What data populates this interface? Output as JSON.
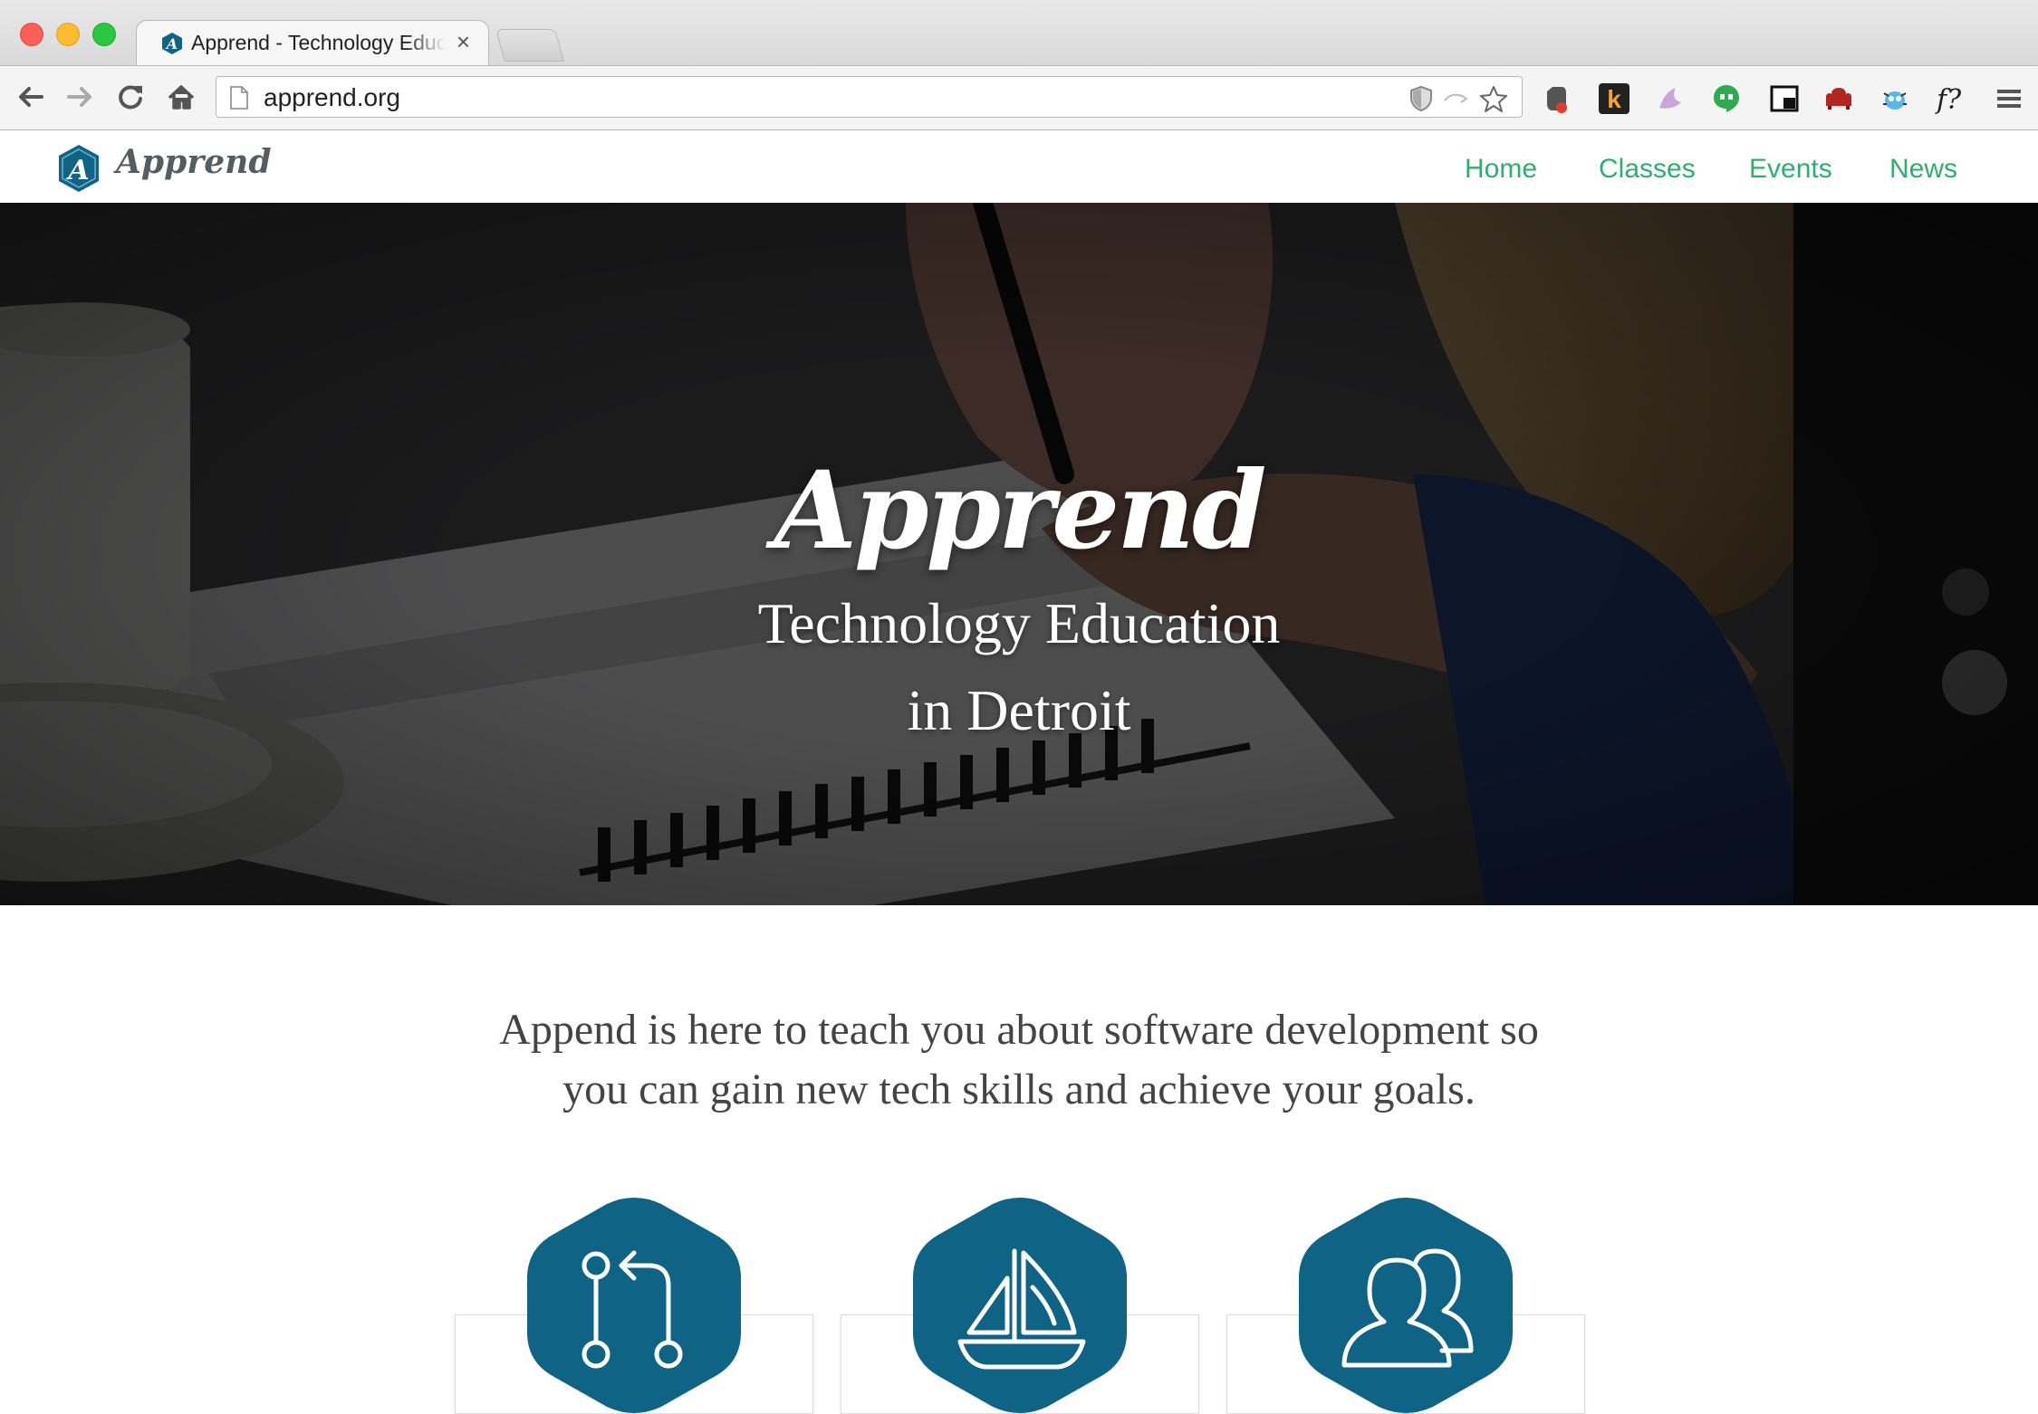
{
  "browser": {
    "tab_title": "Apprend - Technology Education in Detroit",
    "tab_close": "×",
    "address": "apprend.org"
  },
  "site": {
    "logo_text": "Apprend",
    "nav": [
      "Home",
      "Classes",
      "Events",
      "News"
    ],
    "accent_color": "#2bb070",
    "brand_color": "#0f6384"
  },
  "hero": {
    "title": "Apprend",
    "subtitle_line1": "Technology Education",
    "subtitle_line2": "in Detroit"
  },
  "intro": {
    "line1": "Append is here to teach you about software development so",
    "line2": "you can gain new tech skills and achieve your goals."
  },
  "features": [
    {
      "icon": "git-pull-request-icon"
    },
    {
      "icon": "sailboat-icon"
    },
    {
      "icon": "users-icon"
    }
  ]
}
